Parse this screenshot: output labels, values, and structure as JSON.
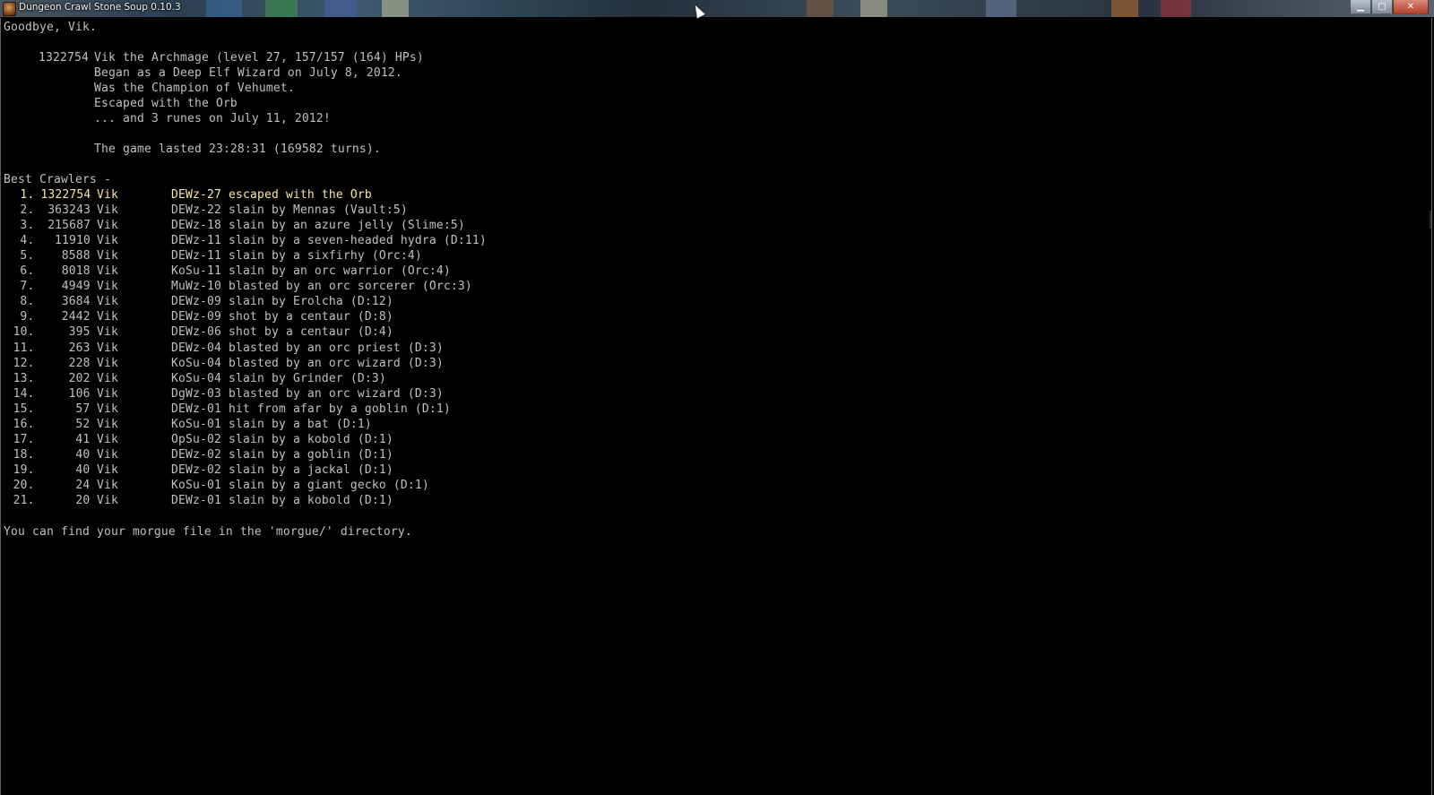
{
  "window": {
    "title": "Dungeon Crawl Stone Soup 0.10.3",
    "controls": {
      "minimize": "▁",
      "maximize": "▢",
      "close": "✕"
    }
  },
  "intro": {
    "farewell": "Goodbye, Vik.",
    "score": "1322754",
    "summary": "Vik the Archmage (level 27, 157/157 (164) HPs)",
    "details": [
      "Began as a Deep Elf Wizard on July 8, 2012.",
      "Was the Champion of Vehumet.",
      "Escaped with the Orb",
      "... and 3 runes on July 11, 2012!"
    ],
    "duration": "The game lasted 23:28:31 (169582 turns)."
  },
  "best_crawlers": {
    "heading": "Best Crawlers -",
    "entries": [
      {
        "rank": "1.",
        "score": "1322754",
        "name": "Vik",
        "desc": "DEWz-27 escaped with the Orb"
      },
      {
        "rank": "2.",
        "score": "363243",
        "name": "Vik",
        "desc": "DEWz-22 slain by Mennas (Vault:5)"
      },
      {
        "rank": "3.",
        "score": "215687",
        "name": "Vik",
        "desc": "DEWz-18 slain by an azure jelly (Slime:5)"
      },
      {
        "rank": "4.",
        "score": "11910",
        "name": "Vik",
        "desc": "DEWz-11 slain by a seven-headed hydra (D:11)"
      },
      {
        "rank": "5.",
        "score": "8588",
        "name": "Vik",
        "desc": "DEWz-11 slain by a sixfirhy (Orc:4)"
      },
      {
        "rank": "6.",
        "score": "8018",
        "name": "Vik",
        "desc": "KoSu-11 slain by an orc warrior (Orc:4)"
      },
      {
        "rank": "7.",
        "score": "4949",
        "name": "Vik",
        "desc": "MuWz-10 blasted by an orc sorcerer (Orc:3)"
      },
      {
        "rank": "8.",
        "score": "3684",
        "name": "Vik",
        "desc": "DEWz-09 slain by Erolcha (D:12)"
      },
      {
        "rank": "9.",
        "score": "2442",
        "name": "Vik",
        "desc": "DEWz-09 shot by a centaur (D:8)"
      },
      {
        "rank": "10.",
        "score": "395",
        "name": "Vik",
        "desc": "DEWz-06 shot by a centaur (D:4)"
      },
      {
        "rank": "11.",
        "score": "263",
        "name": "Vik",
        "desc": "DEWz-04 blasted by an orc priest (D:3)"
      },
      {
        "rank": "12.",
        "score": "228",
        "name": "Vik",
        "desc": "KoSu-04 blasted by an orc wizard (D:3)"
      },
      {
        "rank": "13.",
        "score": "202",
        "name": "Vik",
        "desc": "KoSu-04 slain by Grinder (D:3)"
      },
      {
        "rank": "14.",
        "score": "106",
        "name": "Vik",
        "desc": "DgWz-03 blasted by an orc wizard (D:3)"
      },
      {
        "rank": "15.",
        "score": "57",
        "name": "Vik",
        "desc": "DEWz-01 hit from afar by a goblin (D:1)"
      },
      {
        "rank": "16.",
        "score": "52",
        "name": "Vik",
        "desc": "KoSu-01 slain by a bat (D:1)"
      },
      {
        "rank": "17.",
        "score": "41",
        "name": "Vik",
        "desc": "OpSu-02 slain by a kobold (D:1)"
      },
      {
        "rank": "18.",
        "score": "40",
        "name": "Vik",
        "desc": "DEWz-02 slain by a goblin (D:1)"
      },
      {
        "rank": "19.",
        "score": "40",
        "name": "Vik",
        "desc": "DEWz-02 slain by a jackal (D:1)"
      },
      {
        "rank": "20.",
        "score": "24",
        "name": "Vik",
        "desc": "KoSu-01 slain by a giant gecko (D:1)"
      },
      {
        "rank": "21.",
        "score": "20",
        "name": "Vik",
        "desc": "DEWz-01 slain by a kobold (D:1)"
      }
    ]
  },
  "footer": "You can find your morgue file in the 'morgue/' directory.",
  "colors": {
    "text": "#c0c0c0",
    "highlight": "#f5e8a3",
    "background": "#000000"
  },
  "icons": {
    "app": "dungeon-crawl-app-icon",
    "pointer": "mouse-pointer-icon"
  }
}
